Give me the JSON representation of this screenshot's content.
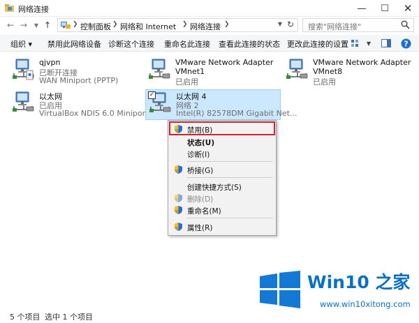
{
  "window": {
    "title": "网络连接",
    "icons": {
      "title": "network-folder-icon",
      "minimize": "minimize-icon",
      "maximize": "maximize-icon",
      "close": "close-icon"
    }
  },
  "address": {
    "breadcrumbs": [
      "控制面板",
      "网络和 Internet",
      "网络连接"
    ],
    "search_placeholder": "搜索\"网络连接\"",
    "icons": {
      "back": "back-arrow-icon",
      "forward": "forward-arrow-icon",
      "recent": "chevron-down-icon",
      "up": "up-arrow-icon",
      "refresh": "refresh-icon",
      "search": "search-icon"
    }
  },
  "toolbar": {
    "organize": "组织 ▾",
    "disable_device": "禁用此网络设备",
    "diagnose": "诊断这个连接",
    "rename": "重命名此连接",
    "view_status": "查看此连接的状态",
    "change_settings": "更改此连接的设置",
    "icons": {
      "view_options": "view-options-icon",
      "preview_pane": "preview-pane-icon",
      "help": "help-icon"
    }
  },
  "connections": [
    {
      "name": "qjvpn",
      "status": "已断开连接",
      "device": "WAN Miniport (PPTP)",
      "icon": "vpn-connection-icon"
    },
    {
      "name": "VMware Network Adapter",
      "status": "VMnet1",
      "device": "已启用",
      "icon": "network-adapter-icon"
    },
    {
      "name": "VMware Network Adapter",
      "status": "VMnet8",
      "device": "已启用",
      "icon": "network-adapter-icon"
    },
    {
      "name": "以太网",
      "status": "已启用",
      "device": "VirtualBox NDIS 6.0 Miniport ...",
      "icon": "ethernet-adapter-icon"
    },
    {
      "name": "以太网 4",
      "status": "网络  2",
      "device": "Intel(R) 82578DM Gigabit Net...",
      "icon": "ethernet-adapter-icon",
      "selected": true
    }
  ],
  "context_menu": {
    "disable": "禁用(B)",
    "status": "状态(U)",
    "diagnose": "诊断(I)",
    "bridge": "桥接(G)",
    "create_shortcut": "创建快捷方式(S)",
    "delete": "删除(D)",
    "rename": "重命名(M)",
    "properties": "属性(R)",
    "icons": {
      "admin": "uac-shield-icon"
    }
  },
  "statusbar": {
    "item_count": "5 个项目",
    "selected_count": "选中 1 个项目"
  },
  "watermark": {
    "title": "Win10 之家",
    "url": "www.win10xitong.com"
  },
  "colors": {
    "selection_bg": "#cce8ff",
    "selection_border": "#99d1ff",
    "highlight_box": "#d4202d",
    "watermark_blue": "#0b6fc4"
  }
}
